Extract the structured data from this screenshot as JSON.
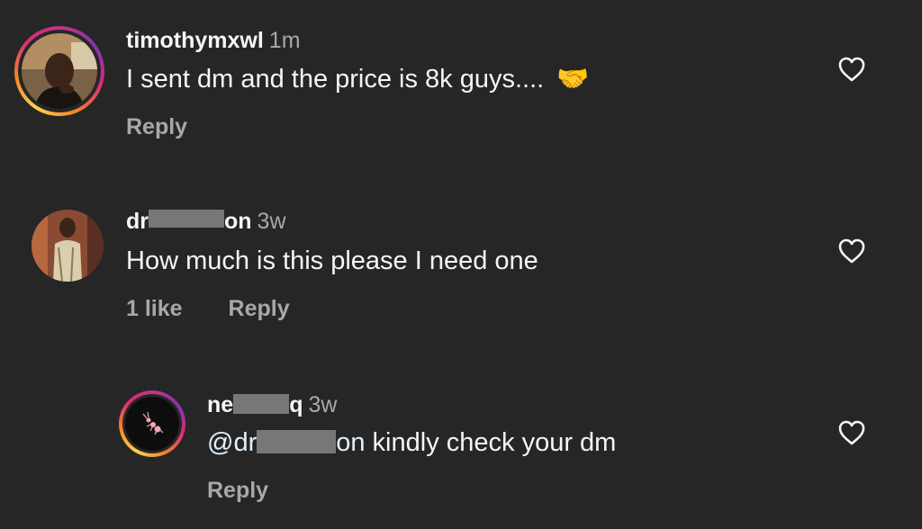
{
  "comments": [
    {
      "username": "timothymxwl",
      "time": "1m",
      "text": "I sent dm and the price is 8k guys....",
      "emoji": "🤝",
      "likes": "",
      "reply_label": "Reply"
    },
    {
      "username_start": "dr",
      "username_end": "on",
      "time": "3w",
      "text": "How much is this please I need one",
      "likes": "1 like",
      "reply_label": "Reply"
    },
    {
      "username_start": "ne",
      "username_end": "q",
      "time": "3w",
      "mention_start": "@dr",
      "mention_end": "on",
      "text_after": " kindly check your dm",
      "reply_label": "Reply"
    }
  ],
  "icons": {
    "like": "heart-outline-icon"
  }
}
